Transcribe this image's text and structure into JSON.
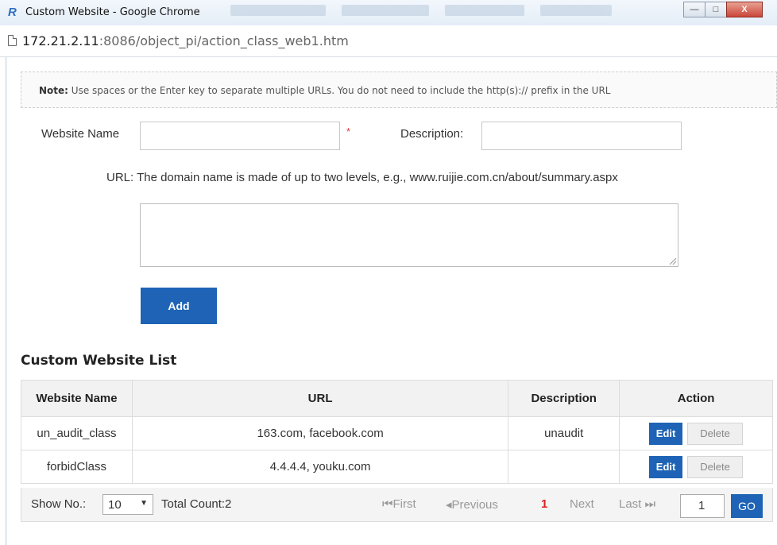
{
  "window": {
    "title": "Custom Website - Google Chrome",
    "app_icon_glyph": "R",
    "minimize_glyph": "—",
    "maximize_glyph": "□",
    "close_glyph": "X"
  },
  "address": {
    "host": "172.21.2.11",
    "path": ":8086/object_pi/action_class_web1.htm"
  },
  "note": {
    "bold": "Note:",
    "text": " Use spaces or the Enter key to separate multiple URLs. You do not need to include the http(s):// prefix in the URL"
  },
  "form": {
    "website_name_label": "Website Name",
    "website_name_value": "",
    "required_mark": "*",
    "description_label": "Description:",
    "description_value": "",
    "url_hint": "URL: The domain name is made of up to two levels, e.g., www.ruijie.com.cn/about/summary.aspx",
    "url_value": "",
    "add_label": "Add"
  },
  "list": {
    "title": "Custom Website List",
    "columns": [
      "Website Name",
      "URL",
      "Description",
      "Action"
    ],
    "rows": [
      {
        "name": "un_audit_class",
        "url": "163.com, facebook.com",
        "description": "unaudit"
      },
      {
        "name": "forbidClass",
        "url": "4.4.4.4, youku.com",
        "description": ""
      }
    ],
    "edit_label": "Edit",
    "delete_label": "Delete"
  },
  "pager": {
    "show_label": "Show No.:",
    "page_size": "10",
    "total": "Total Count:2",
    "first": "First",
    "previous": "Previous",
    "current": "1",
    "next": "Next",
    "last": "Last",
    "page_input": "1",
    "go": "GO"
  }
}
